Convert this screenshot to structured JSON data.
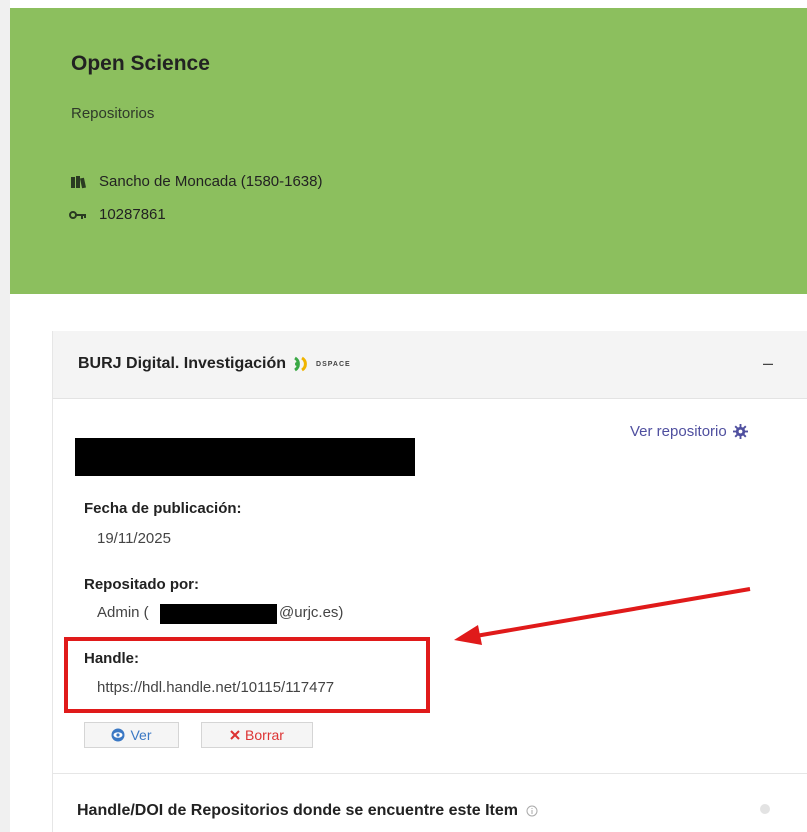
{
  "banner": {
    "title": "Open Science",
    "subtitle": "Repositorios",
    "author": "Sancho de Moncada (1580-1638)",
    "id_value": "10287861",
    "background_color": "#8cbf5e"
  },
  "repository_panel": {
    "title": "BURJ Digital. Investigación",
    "logo_text": "DSPACE",
    "collapse_symbol": "–",
    "view_repository_link": "Ver repositorio",
    "fields": {
      "publication_date_label": "Fecha de publicación:",
      "publication_date_value": "19/11/2025",
      "deposited_by_label": "Repositado por:",
      "deposited_by_prefix": "Admin (",
      "deposited_by_suffix": "@urjc.es)",
      "handle_label": "Handle:",
      "handle_value": "https://hdl.handle.net/10115/117477"
    },
    "buttons": {
      "view_label": "Ver",
      "delete_label": "Borrar"
    }
  },
  "section2": {
    "title": "Handle/DOI de Repositorios donde se encuentre este Item"
  },
  "colors": {
    "highlight": "#e01a1a",
    "link": "#4f4f9f",
    "view_button": "#3a78c4",
    "delete_button": "#dd3333"
  }
}
